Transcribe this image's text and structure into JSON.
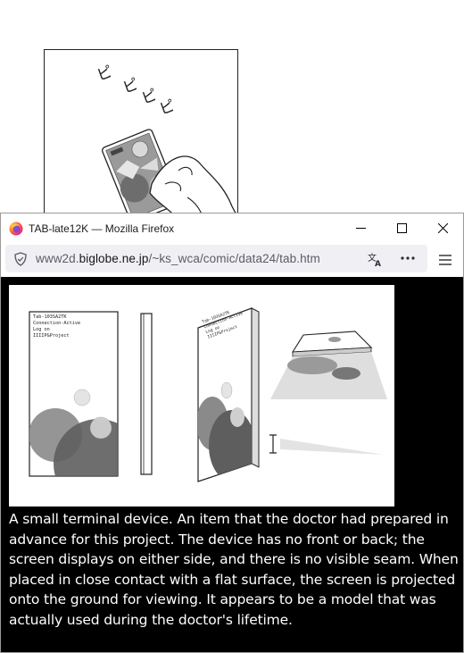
{
  "manga": {
    "sfx": [
      "ピ",
      "ピ",
      "ピ",
      "ピ"
    ]
  },
  "window": {
    "title": "TAB-late12K — Mozilla Firefox"
  },
  "urlbar": {
    "url_prefix": "www2d.",
    "url_domain": "biglobe.ne.jp",
    "url_path": "/~ks_wca/comic/data24/tab.htm"
  },
  "figure": {
    "device_text": "Tab-103SA2TK\nConnection-Active\nLog on\nIIIIP&Project"
  },
  "description": "A small terminal device. An item that the doctor had prepared in advance for this project. The device has no front or back; the screen displays on either side, and there is no visible seam. When placed in close contact with a flat surface, the screen is projected onto the ground for viewing. It appears to be a model that was actually used during the doctor's lifetime.",
  "icons": {
    "app": "firefox-logo-icon",
    "security": "shield-icon",
    "translate": "translate-icon",
    "more": "more-icon",
    "menu": "hamburger-menu-icon",
    "minimize": "minimize-icon",
    "maximize": "maximize-icon",
    "close": "close-icon"
  }
}
